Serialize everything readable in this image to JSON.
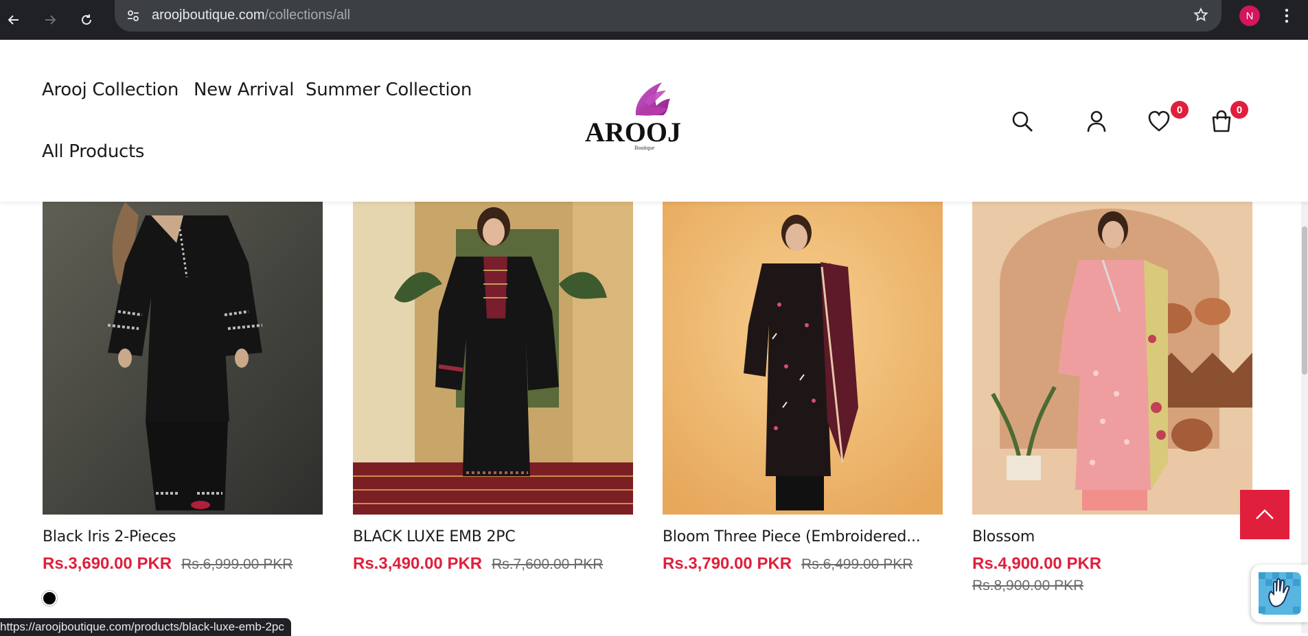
{
  "browser": {
    "url_host": "aroojboutique.com",
    "url_path": "/collections/all",
    "profile_initial": "N",
    "status_url": "https://aroojboutique.com/products/black-luxe-emb-2pc"
  },
  "header": {
    "nav": [
      {
        "label": "Arooj Collection"
      },
      {
        "label": "New Arrival"
      },
      {
        "label": "Summer Collection"
      },
      {
        "label": "All Products"
      }
    ],
    "logo_text": "AROOJ",
    "logo_sub": "Boutique",
    "wishlist_count": "0",
    "cart_count": "0"
  },
  "products": [
    {
      "title": "Black Iris 2-Pieces",
      "price": "Rs.3,690.00 PKR",
      "compare_price": "Rs.6,999.00 PKR"
    },
    {
      "title": "BLACK LUXE EMB 2PC",
      "price": "Rs.3,490.00 PKR",
      "compare_price": "Rs.7,600.00 PKR"
    },
    {
      "title": "Bloom Three Piece (Embroidered...",
      "price": "Rs.3,790.00 PKR",
      "compare_price": "Rs.6,499.00 PKR"
    },
    {
      "title": "Blossom",
      "price": "Rs.4,900.00 PKR",
      "compare_price": "Rs.8,900.00 PKR"
    }
  ],
  "colors": {
    "accent": "#e01f3c",
    "chrome_dark": "#202124",
    "logo_purple": "#b43aa8"
  }
}
